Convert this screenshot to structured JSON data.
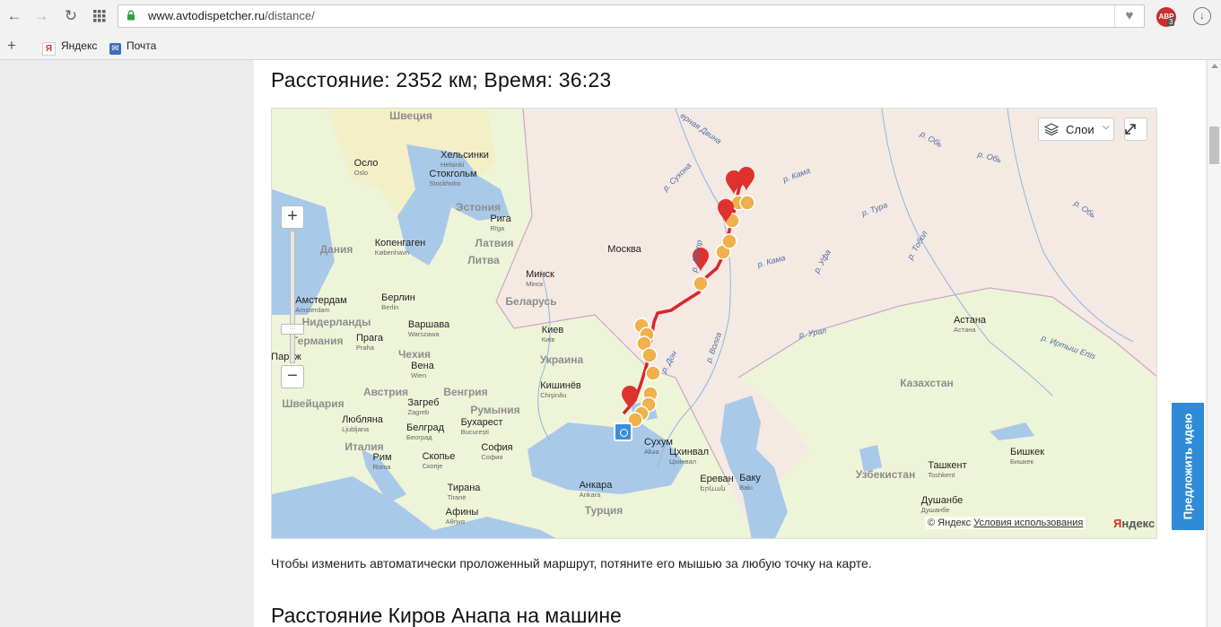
{
  "browser": {
    "url_host": "www.avtodispetcher.ru",
    "url_path": "/distance/",
    "bookmarks": [
      {
        "label": "Яндекс",
        "icon": "yandex-icon"
      },
      {
        "label": "Почта",
        "icon": "mail-icon"
      }
    ],
    "abp_label": "ABP",
    "abp_count": "3"
  },
  "page": {
    "heading": "Расстояние: 2352 км; Время: 36:23",
    "hint": "Чтобы изменить автоматически проложенный маршрут, потяните его мышью за любую точку на карте.",
    "subheading": "Расстояние Киров Анапа на машине",
    "feedback_label": "Предложить идею"
  },
  "map": {
    "layers_label": "Слои",
    "copyright": "© Яндекс",
    "terms_link": "Условия использования",
    "logo_prefix": "Я",
    "logo_rest": "ндекс",
    "colors": {
      "route": "#d9262c",
      "marker": "#e0322d",
      "fuel": "#f0b04a",
      "water": "#a9c9e8",
      "russia": "#f5e9e4",
      "other": "#eef4d8"
    },
    "cities": [
      {
        "ru": "Осло",
        "loc": "Oslo"
      },
      {
        "ru": "Хельсинки",
        "loc": "Helsinki"
      },
      {
        "ru": "Стокгольм",
        "loc": "Stockholm"
      },
      {
        "ru": "Рига",
        "loc": "Rīga"
      },
      {
        "ru": "Копенгаген",
        "loc": "København"
      },
      {
        "ru": "Минск",
        "loc": "Мінск"
      },
      {
        "ru": "Москва",
        "loc": ""
      },
      {
        "ru": "Амстердам",
        "loc": "Amsterdam"
      },
      {
        "ru": "Берлин",
        "loc": "Berlin"
      },
      {
        "ru": "Варшава",
        "loc": "Warszawa"
      },
      {
        "ru": "Прага",
        "loc": "Praha"
      },
      {
        "ru": "Париж",
        "loc": ""
      },
      {
        "ru": "Вена",
        "loc": "Wien"
      },
      {
        "ru": "Киев",
        "loc": "Київ"
      },
      {
        "ru": "Кишинёв",
        "loc": "Chişinău"
      },
      {
        "ru": "Загреб",
        "loc": "Zagreb"
      },
      {
        "ru": "Бухарест",
        "loc": "București"
      },
      {
        "ru": "Любляна",
        "loc": "Ljubljana"
      },
      {
        "ru": "Белград",
        "loc": "Београд"
      },
      {
        "ru": "София",
        "loc": "София"
      },
      {
        "ru": "Рим",
        "loc": "Roma"
      },
      {
        "ru": "Скопье",
        "loc": "Скопје"
      },
      {
        "ru": "Тирана",
        "loc": "Tiranë"
      },
      {
        "ru": "Афины",
        "loc": "Αθήνα"
      },
      {
        "ru": "Анкара",
        "loc": "Ankara"
      },
      {
        "ru": "Сухум",
        "loc": "Аҟәа"
      },
      {
        "ru": "Цхинвал",
        "loc": "Цхинвал"
      },
      {
        "ru": "Ереван",
        "loc": "Երևան"
      },
      {
        "ru": "Баку",
        "loc": "Bakı"
      },
      {
        "ru": "Астана",
        "loc": "Астана"
      },
      {
        "ru": "Ташкент",
        "loc": "Toshkent"
      },
      {
        "ru": "Бишкек",
        "loc": "Бишкек"
      },
      {
        "ru": "Душанбе",
        "loc": "Душанбе"
      }
    ],
    "countries": [
      "Швеция",
      "Эстония",
      "Латвия",
      "Литва",
      "Дания",
      "Беларусь",
      "Нидерланды",
      "Германия",
      "Чехия",
      "Украина",
      "Австрия",
      "Венгрия",
      "Швейцария",
      "Румыния",
      "Италия",
      "Турция",
      "Казахстан",
      "Узбекистан"
    ],
    "rivers": [
      "ерная Двина",
      "р. Сухона",
      "р. Кама",
      "р. Обь",
      "р. Обь",
      "р. Обь",
      "р. Тура",
      "р. Тобол",
      "р. Уфа",
      "р. Кама",
      "р. Урал",
      "р. Иртыш Ertis",
      "р. Волга",
      "р. Дон",
      "р. Днепр"
    ]
  }
}
